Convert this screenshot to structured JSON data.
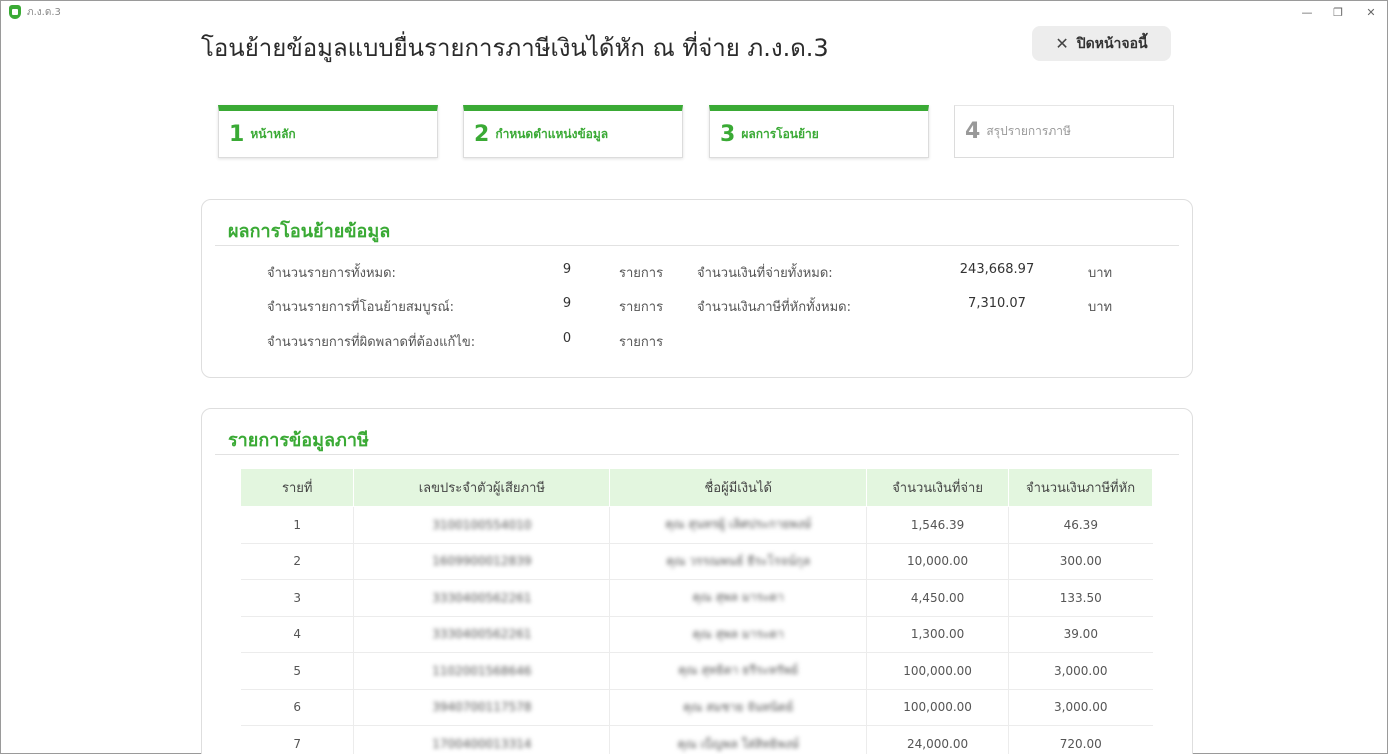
{
  "window": {
    "app_name": "ภ.ง.ด.3",
    "minimize": "—",
    "maximize": "❐",
    "close": "✕"
  },
  "header": {
    "title": "โอนย้ายข้อมูลแบบยื่นรายการภาษีเงินได้หัก ณ ที่จ่าย ภ.ง.ด.3",
    "close_button": "ปิดหน้าจอนี้",
    "close_glyph": "✕"
  },
  "steps": [
    {
      "num": "1",
      "label": "หน้าหลัก",
      "state": "done"
    },
    {
      "num": "2",
      "label": "กำหนดตำแหน่งข้อมูล",
      "state": "done"
    },
    {
      "num": "3",
      "label": "ผลการโอนย้าย",
      "state": "current"
    },
    {
      "num": "4",
      "label": "สรุปรายการภาษี",
      "state": "pending"
    }
  ],
  "summary": {
    "heading": "ผลการโอนย้ายข้อมูล",
    "total_label": "จำนวนรายการทั้งหมด:",
    "total_value": "9",
    "complete_label": "จำนวนรายการที่โอนย้ายสมบูรณ์:",
    "complete_value": "9",
    "error_label": "จำนวนรายการที่ผิดพลาดที่ต้องแก้ไข:",
    "error_value": "0",
    "item_unit": "รายการ",
    "paid_label": "จำนวนเงินที่จ่ายทั้งหมด:",
    "paid_value": "243,668.97",
    "tax_label": "จำนวนเงินภาษีที่หักทั้งหมด:",
    "tax_value": "7,310.07",
    "baht_unit": "บาท"
  },
  "tax_table": {
    "heading": "รายการข้อมูลภาษี",
    "columns": [
      "รายที่",
      "เลขประจำตัวผู้เสียภาษี",
      "ชื่อผู้มีเงินได้",
      "จำนวนเงินที่จ่าย",
      "จำนวนเงินภาษีที่หัก"
    ],
    "rows": [
      {
        "no": "1",
        "tax_id": "3100100554010",
        "name": "คุณ สุนทรผู้ เลิศประกายพงษ์",
        "paid": "1,546.39",
        "tax": "46.39"
      },
      {
        "no": "2",
        "tax_id": "1609900012839",
        "name": "คุณ วรรณพนธ์ ธีระโรจน์กุล",
        "paid": "10,000.00",
        "tax": "300.00"
      },
      {
        "no": "3",
        "tax_id": "3330400562261",
        "name": "คุณ สุพล มาระดา",
        "paid": "4,450.00",
        "tax": "133.50"
      },
      {
        "no": "4",
        "tax_id": "3330400562261",
        "name": "คุณ สุพล มาระดา",
        "paid": "1,300.00",
        "tax": "39.00"
      },
      {
        "no": "5",
        "tax_id": "1102001568646",
        "name": "คุณ สุทธิดา ธรีระทรัพย์",
        "paid": "100,000.00",
        "tax": "3,000.00"
      },
      {
        "no": "6",
        "tax_id": "3940700117578",
        "name": "คุณ สมชาย จันทนิตย์",
        "paid": "100,000.00",
        "tax": "3,000.00"
      },
      {
        "no": "7",
        "tax_id": "1700400013314",
        "name": "คุณ เบ็ญพล ใส่สิทธิพงษ์",
        "paid": "24,000.00",
        "tax": "720.00"
      }
    ]
  },
  "colors": {
    "accent": "#3aaa35",
    "header_bg": "#e3f6df"
  }
}
